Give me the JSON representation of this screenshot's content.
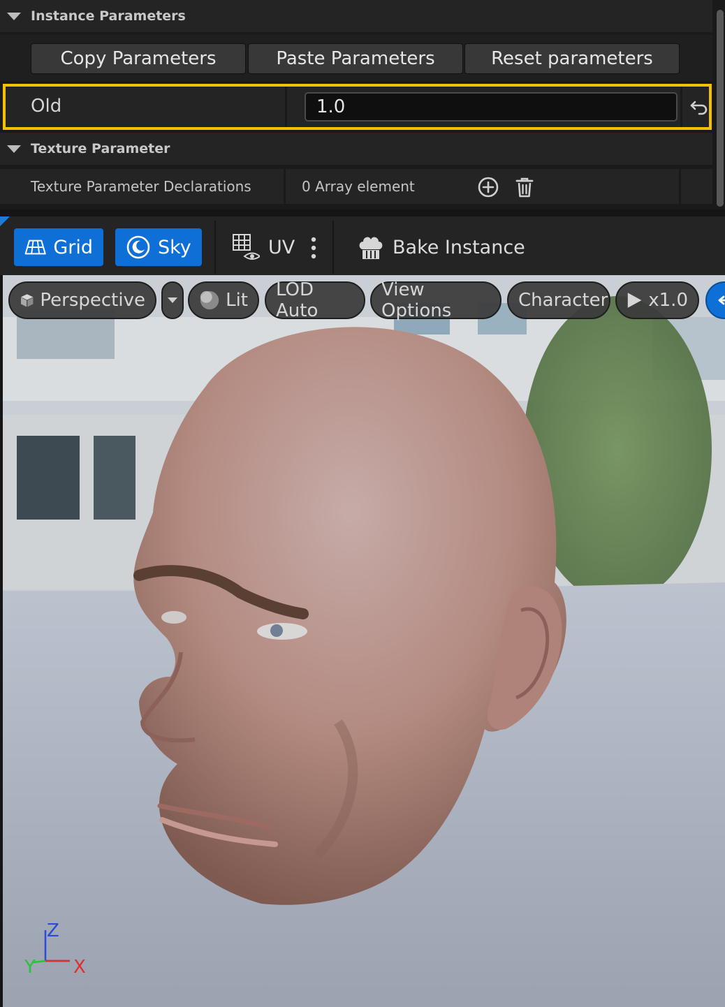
{
  "instance_parameters": {
    "header": "Instance Parameters",
    "copy_label": "Copy Parameters",
    "paste_label": "Paste Parameters",
    "reset_label": "Reset parameters",
    "old_param": {
      "name": "Old",
      "value": "1.0"
    }
  },
  "texture_parameter": {
    "header": "Texture Parameter",
    "declarations_label": "Texture Parameter Declarations",
    "array_count": "0 Array element"
  },
  "toolbar": {
    "grid_label": "Grid",
    "sky_label": "Sky",
    "uv_label": "UV",
    "bake_label": "Bake Instance"
  },
  "viewport": {
    "perspective_label": "Perspective",
    "lit_label": "Lit",
    "lod_label": "LOD Auto",
    "view_options_label": "View Options",
    "character_label": "Character",
    "speed_label": "x1.0",
    "axes": {
      "z": "Z",
      "x": "X",
      "y": "Y"
    }
  },
  "colors": {
    "accent_blue": "#0e70d7",
    "highlight_yellow": "#f2c100",
    "panel_bg": "#1a1a1a"
  }
}
